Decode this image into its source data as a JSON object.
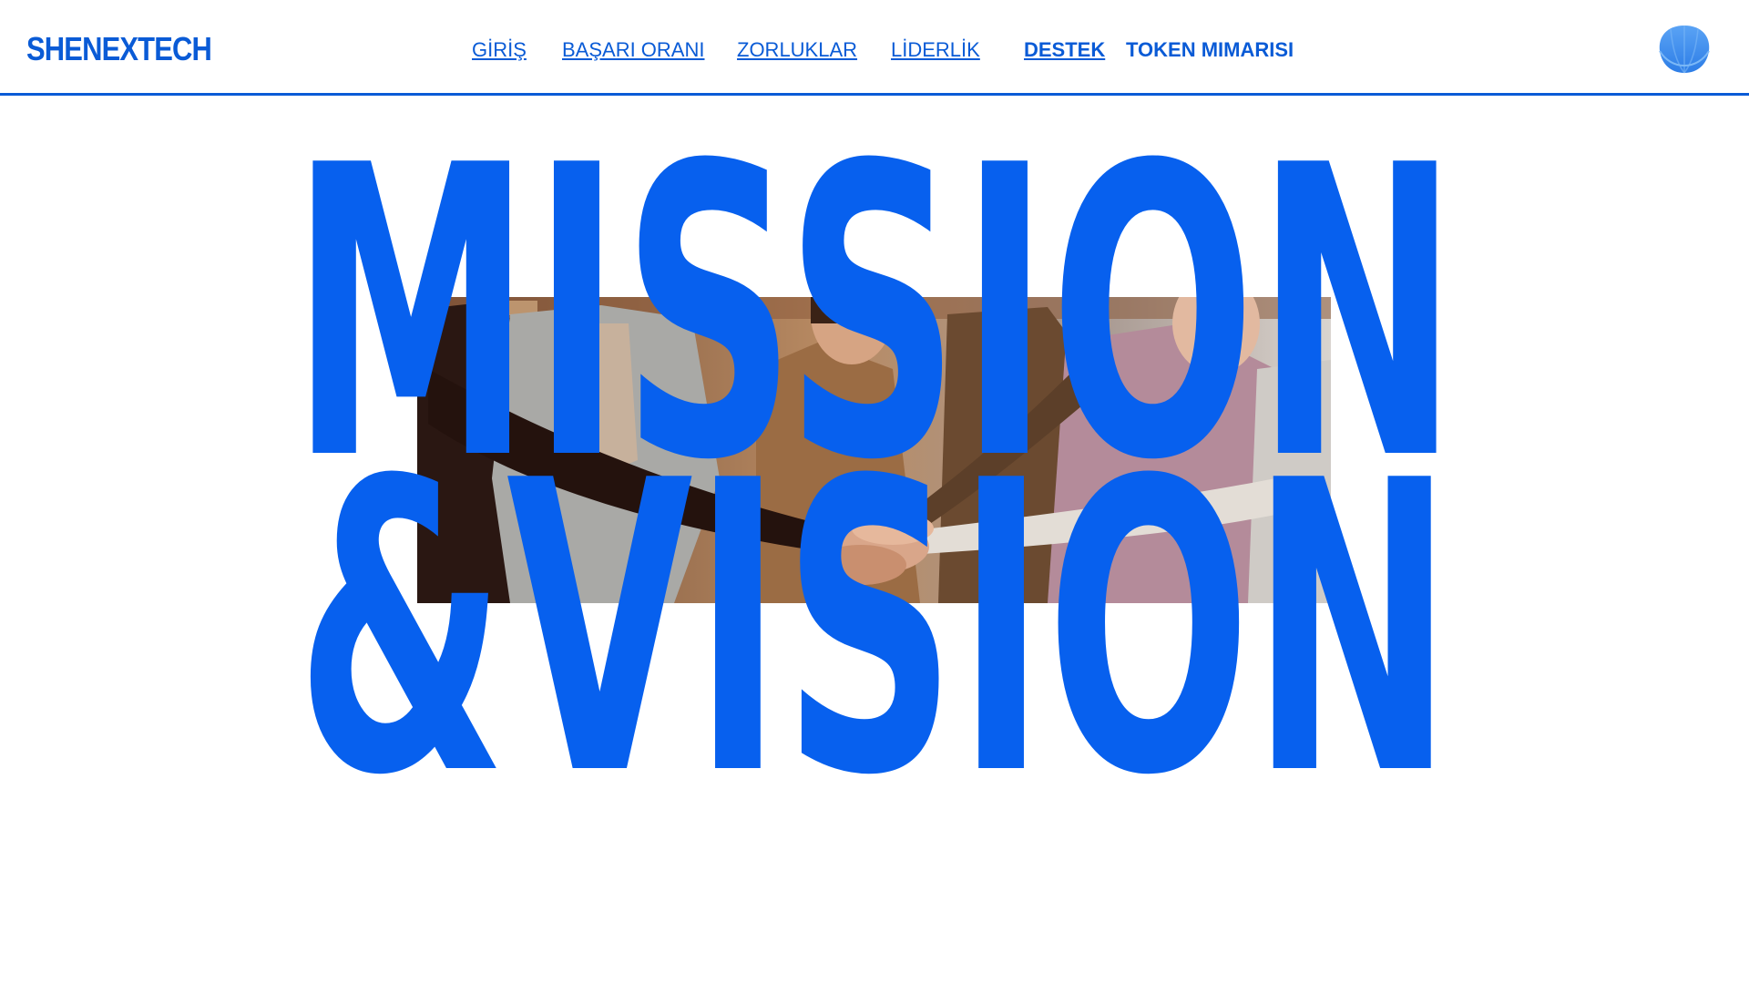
{
  "header": {
    "logo": "SHENEXTECH",
    "nav": [
      {
        "label": "GİRİŞ"
      },
      {
        "label": "BAŞARI ORANI"
      },
      {
        "label": "ZORLUKLAR"
      },
      {
        "label": "LİDERLİK"
      },
      {
        "label": "DESTEK"
      },
      {
        "label": "TOKEN MIMARISI"
      }
    ],
    "menu_icon": "shell-icon"
  },
  "hero": {
    "line1": "MISSION",
    "line2": "&VISION",
    "photo_icon": "team-hands-photo"
  },
  "colors": {
    "brand": "#0a5bd6",
    "hero_text": "#0760ee",
    "background": "#ffffff"
  }
}
